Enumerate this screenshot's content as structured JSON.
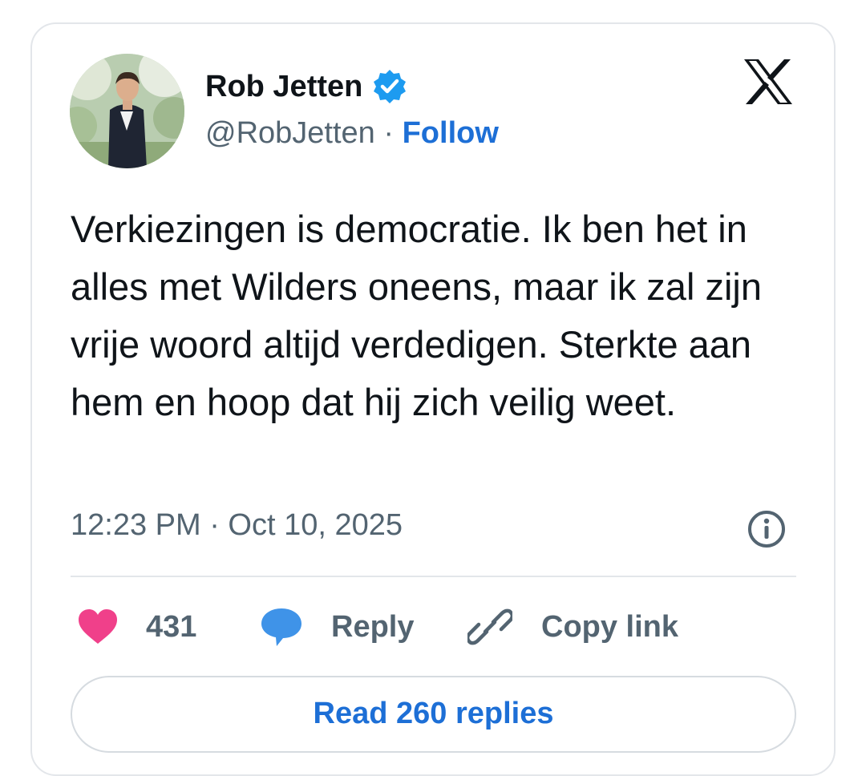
{
  "author": {
    "name": "Rob Jetten",
    "handle": "@RobJetten",
    "separator": "·",
    "follow_label": "Follow"
  },
  "tweet": {
    "text": "Verkiezingen is democratie. Ik ben het in alles met Wilders oneens, maar ik zal zijn vrije woord altijd verdedigen. Sterkte aan hem en hoop dat hij zich veilig weet.",
    "timestamp": "12:23 PM · Oct 10, 2025"
  },
  "actions": {
    "like_count": "431",
    "reply_label": "Reply",
    "copy_link_label": "Copy link"
  },
  "read_replies_label": "Read 260 replies",
  "icons": {
    "verified": "verified-badge-icon",
    "platform": "x-logo-icon",
    "info": "info-icon",
    "like": "heart-icon",
    "reply": "speech-bubble-icon",
    "copy": "link-icon"
  },
  "colors": {
    "link_blue": "#1d6fd6",
    "verified_blue": "#1d9bf0",
    "heart_pink": "#f0408a",
    "reply_blue": "#3f93e8",
    "text_primary": "#0f1419",
    "text_secondary": "#536471"
  }
}
